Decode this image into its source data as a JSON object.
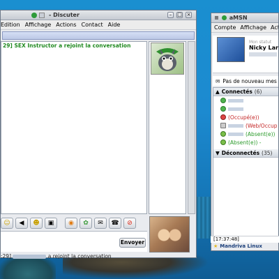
{
  "chat": {
    "title": "- Discuter",
    "menu": [
      "Edition",
      "Affichage",
      "Actions",
      "Contact",
      "Aide"
    ],
    "conversation_line": "29] SEX Instructor a rejoint la conversation",
    "send_label": "Envoyer",
    "status_prefix": ":29]",
    "status_suffix": "a rejoint la conversation",
    "toolbar_icons": [
      "smiley-icon",
      "play-icon",
      "wink-icon",
      "camera-icon",
      "nudge-icon",
      "webcam-icon",
      "send-file-icon",
      "call-icon",
      "block-icon"
    ]
  },
  "amsn": {
    "title": "aMSN",
    "menu": [
      "Compte",
      "Affichage",
      "Actions"
    ],
    "my_status": "Mon statut",
    "my_name": "Nicky Lars",
    "no_new_mail": "Pas de nouveau mes",
    "groups": {
      "connected_label": "Connectés",
      "connected_count": "(6)",
      "disconnected_label": "Déconnectés",
      "disconnected_count": "(35)"
    },
    "contacts": [
      {
        "status": "",
        "icon": "online"
      },
      {
        "status": "",
        "icon": "online"
      },
      {
        "status": "(Occupé(e))",
        "icon": "busy"
      },
      {
        "status": "(Web/Occup",
        "icon": "block"
      },
      {
        "status": "(Absent(e))",
        "icon": "away"
      },
      {
        "status": "(Absent(e)) -",
        "icon": "away"
      }
    ],
    "time": "[17:37:48]",
    "distro": "Mandriva Linux"
  }
}
